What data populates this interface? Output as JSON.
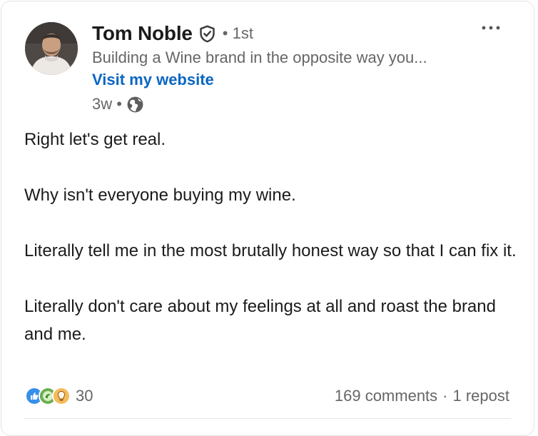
{
  "author": {
    "name": "Tom Noble",
    "degree": "1st",
    "headline": "Building a Wine brand in the opposite way you...",
    "website_link": "Visit my website",
    "time_ago": "3w"
  },
  "post": {
    "paragraphs": [
      "Right let's get real.",
      "Why isn't everyone buying my wine.",
      "Literally tell me in the most brutally honest way so that I can fix it.",
      "Literally don't care about my feelings at all and roast the brand and me."
    ]
  },
  "social": {
    "reactions_count": "30",
    "reaction_icons": [
      "like-icon",
      "celebrate-icon",
      "insightful-icon"
    ],
    "comments": "169 comments",
    "separator": "·",
    "reposts": "1 repost"
  },
  "colors": {
    "link": "#0a66c2",
    "secondary_text": "#666666",
    "primary_text": "#1b1b1b"
  }
}
